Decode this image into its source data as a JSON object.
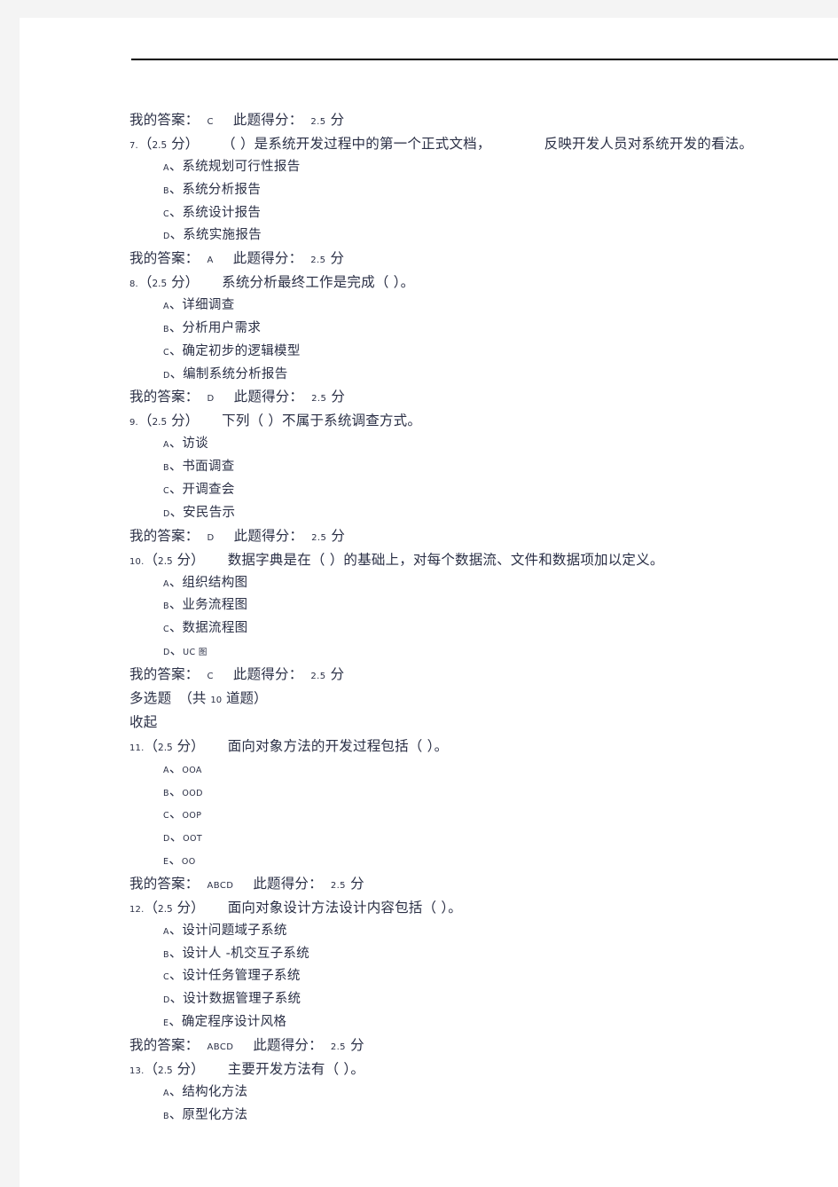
{
  "page": {
    "header_rule": true
  },
  "blocks": [
    {
      "kind": "answer",
      "name": "answer-line-q6",
      "label": "我的答案：",
      "value": "C",
      "score_label": "此题得分：",
      "score_value": "2.5",
      "score_unit": "分"
    },
    {
      "kind": "question",
      "name": "question-7",
      "number": "7.",
      "score_open": "（",
      "score_value": "2.5",
      "score_unit": "分",
      "score_close": "）",
      "text": "（  ）是系统开发过程中的第一个正式文档，",
      "text_tail": "反映开发人员对系统开发的看法。",
      "has_wide_gap": true
    },
    {
      "kind": "option",
      "name": "option-7-a",
      "letter": "A",
      "sep": "、",
      "text": "系统规划可行性报告",
      "latin": false
    },
    {
      "kind": "option",
      "name": "option-7-b",
      "letter": "B",
      "sep": "、",
      "text": "系统分析报告",
      "latin": false
    },
    {
      "kind": "option",
      "name": "option-7-c",
      "letter": "C",
      "sep": "、",
      "text": "系统设计报告",
      "latin": false
    },
    {
      "kind": "option",
      "name": "option-7-d",
      "letter": "D",
      "sep": "、",
      "text": "系统实施报告",
      "latin": false
    },
    {
      "kind": "answer",
      "name": "answer-line-q7",
      "label": "我的答案：",
      "value": "A",
      "score_label": "此题得分：",
      "score_value": "2.5",
      "score_unit": "分"
    },
    {
      "kind": "question",
      "name": "question-8",
      "number": "8.",
      "score_open": "（",
      "score_value": "2.5",
      "score_unit": "分",
      "score_close": "）",
      "text": "系统分析最终工作是完成（    ）。",
      "text_tail": "",
      "has_wide_gap": false
    },
    {
      "kind": "option",
      "name": "option-8-a",
      "letter": "A",
      "sep": "、",
      "text": "详细调查",
      "latin": false
    },
    {
      "kind": "option",
      "name": "option-8-b",
      "letter": "B",
      "sep": "、",
      "text": "分析用户需求",
      "latin": false
    },
    {
      "kind": "option",
      "name": "option-8-c",
      "letter": "C",
      "sep": "、",
      "text": "确定初步的逻辑模型",
      "latin": false
    },
    {
      "kind": "option",
      "name": "option-8-d",
      "letter": "D",
      "sep": "、",
      "text": "编制系统分析报告",
      "latin": false
    },
    {
      "kind": "answer",
      "name": "answer-line-q8",
      "label": "我的答案：",
      "value": "D",
      "score_label": "此题得分：",
      "score_value": "2.5",
      "score_unit": "分"
    },
    {
      "kind": "question",
      "name": "question-9",
      "number": "9.",
      "score_open": "（",
      "score_value": "2.5",
      "score_unit": "分",
      "score_close": "）",
      "text": "下列（  ）不属于系统调查方式。",
      "text_tail": "",
      "has_wide_gap": false
    },
    {
      "kind": "option",
      "name": "option-9-a",
      "letter": "A",
      "sep": "、",
      "text": "访谈",
      "latin": false
    },
    {
      "kind": "option",
      "name": "option-9-b",
      "letter": "B",
      "sep": "、",
      "text": "书面调查",
      "latin": false
    },
    {
      "kind": "option",
      "name": "option-9-c",
      "letter": "C",
      "sep": "、",
      "text": "开调查会",
      "latin": false
    },
    {
      "kind": "option",
      "name": "option-9-d",
      "letter": "D",
      "sep": "、",
      "text": "安民告示",
      "latin": false
    },
    {
      "kind": "answer",
      "name": "answer-line-q9",
      "label": "我的答案：",
      "value": "D",
      "score_label": "此题得分：",
      "score_value": "2.5",
      "score_unit": "分"
    },
    {
      "kind": "question",
      "name": "question-10",
      "number": "10.",
      "score_open": "（",
      "score_value": "2.5",
      "score_unit": "分",
      "score_close": "）",
      "text": "数据字典是在（   ）的基础上，对每个数据流、文件和数据项加以定义。",
      "text_tail": "",
      "has_wide_gap": false
    },
    {
      "kind": "option",
      "name": "option-10-a",
      "letter": "A",
      "sep": "、",
      "text": "组织结构图",
      "latin": false
    },
    {
      "kind": "option",
      "name": "option-10-b",
      "letter": "B",
      "sep": "、",
      "text": "业务流程图",
      "latin": false
    },
    {
      "kind": "option",
      "name": "option-10-c",
      "letter": "C",
      "sep": "、",
      "text": "数据流程图",
      "latin": false
    },
    {
      "kind": "option",
      "name": "option-10-d",
      "letter": "D",
      "sep": "、",
      "text": "UC 图",
      "latin": true
    },
    {
      "kind": "answer",
      "name": "answer-line-q10",
      "label": "我的答案：",
      "value": "C",
      "score_label": "此题得分：",
      "score_value": "2.5",
      "score_unit": "分"
    },
    {
      "kind": "section",
      "name": "section-heading-multiple-choice",
      "title": "多选题",
      "count_open": "（共",
      "count_value": "10",
      "count_close": "道题）"
    },
    {
      "kind": "collapse",
      "name": "collapse-toggle",
      "text": "收起"
    },
    {
      "kind": "question",
      "name": "question-11",
      "number": "11.",
      "score_open": "（",
      "score_value": "2.5",
      "score_unit": "分",
      "score_close": "）",
      "text": "面向对象方法的开发过程包括（     ）。",
      "text_tail": "",
      "has_wide_gap": false
    },
    {
      "kind": "option",
      "name": "option-11-a",
      "letter": "A",
      "sep": "、",
      "text": "OOA",
      "latin": true
    },
    {
      "kind": "option",
      "name": "option-11-b",
      "letter": "B",
      "sep": "、",
      "text": "OOD",
      "latin": true
    },
    {
      "kind": "option",
      "name": "option-11-c",
      "letter": "C",
      "sep": "、",
      "text": "OOP",
      "latin": true
    },
    {
      "kind": "option",
      "name": "option-11-d",
      "letter": "D",
      "sep": "、",
      "text": "OOT",
      "latin": true
    },
    {
      "kind": "option",
      "name": "option-11-e",
      "letter": "E",
      "sep": "、",
      "text": "OO",
      "latin": true
    },
    {
      "kind": "answer",
      "name": "answer-line-q11",
      "label": "我的答案：",
      "value": "ABCD",
      "score_label": "此题得分：",
      "score_value": "2.5",
      "score_unit": "分"
    },
    {
      "kind": "question",
      "name": "question-12",
      "number": "12.",
      "score_open": "（",
      "score_value": "2.5",
      "score_unit": "分",
      "score_close": "）",
      "text": "面向对象设计方法设计内容包括（     ）。",
      "text_tail": "",
      "has_wide_gap": false
    },
    {
      "kind": "option",
      "name": "option-12-a",
      "letter": "A",
      "sep": "、",
      "text": "设计问题域子系统",
      "latin": false
    },
    {
      "kind": "option",
      "name": "option-12-b",
      "letter": "B",
      "sep": "、",
      "text": "设计人 -机交互子系统",
      "latin": false
    },
    {
      "kind": "option",
      "name": "option-12-c",
      "letter": "C",
      "sep": "、",
      "text": "设计任务管理子系统",
      "latin": false
    },
    {
      "kind": "option",
      "name": "option-12-d",
      "letter": "D",
      "sep": "、",
      "text": "设计数据管理子系统",
      "latin": false
    },
    {
      "kind": "option",
      "name": "option-12-e",
      "letter": "E",
      "sep": "、",
      "text": "确定程序设计风格",
      "latin": false
    },
    {
      "kind": "answer",
      "name": "answer-line-q12",
      "label": "我的答案：",
      "value": "ABCD",
      "score_label": "此题得分：",
      "score_value": "2.5",
      "score_unit": "分"
    },
    {
      "kind": "question",
      "name": "question-13",
      "number": "13.",
      "score_open": "（",
      "score_value": "2.5",
      "score_unit": "分",
      "score_close": "）",
      "text": "主要开发方法有（   ）。",
      "text_tail": "",
      "has_wide_gap": false
    },
    {
      "kind": "option",
      "name": "option-13-a",
      "letter": "A",
      "sep": "、",
      "text": "结构化方法",
      "latin": false
    },
    {
      "kind": "option",
      "name": "option-13-b",
      "letter": "B",
      "sep": "、",
      "text": "原型化方法",
      "latin": false
    }
  ]
}
